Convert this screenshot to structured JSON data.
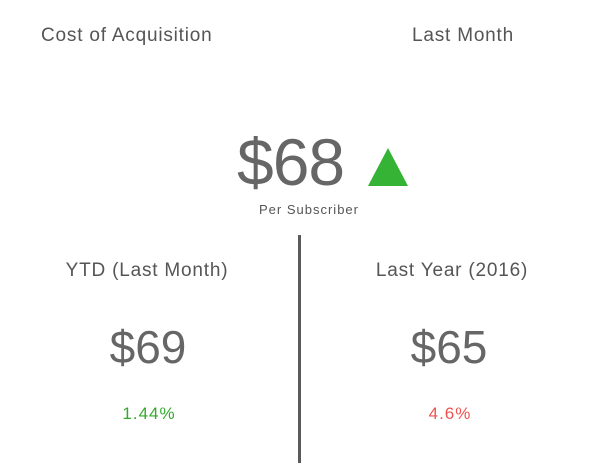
{
  "header": {
    "title": "Cost of Acquisition",
    "period": "Last Month"
  },
  "main": {
    "value": "$68",
    "caption": "Per Subscriber",
    "trend_icon": "triangle-up-icon",
    "trend_color": "#35b335"
  },
  "ytd": {
    "label": "YTD (Last Month)",
    "value": "$69",
    "change": "1.44%",
    "change_color": "#33aa2b"
  },
  "last_year": {
    "label": "Last Year (2016)",
    "value": "$65",
    "change": "4.6%",
    "change_color": "#f0524f"
  }
}
